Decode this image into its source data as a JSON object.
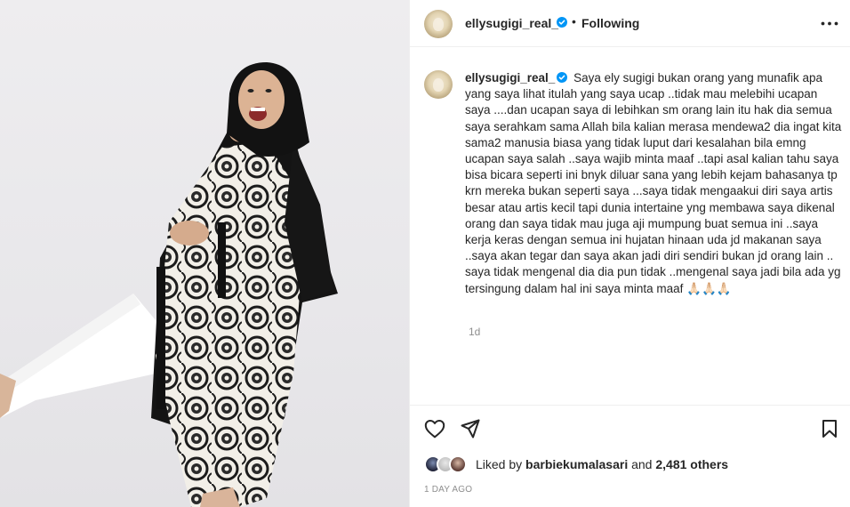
{
  "post": {
    "username": "ellysugigi_real_",
    "separator": "•",
    "follow_status": "Following",
    "caption_text": "Saya ely sugigi bukan orang yang munafik apa yang saya lihat itulah yang saya ucap ..tidak mau melebihi ucapan saya ....dan ucapan saya di lebihkan sm orang lain itu hak dia semua saya serahkam sama Allah bila kalian merasa mendewa2 dia ingat kita sama2 manusia biasa yang tidak luput dari kesalahan bila emng ucapan saya salah ..saya wajib minta maaf ..tapi asal kalian tahu saya bisa bicara seperti ini bnyk diluar sana yang lebih kejam bahasanya tp krn mereka bukan seperti saya ...saya tidak mengaakui diri saya artis besar atau artis kecil tapi dunia intertaine yng membawa saya dikenal orang dan saya tidak mau juga aji mumpung buat semua ini ..saya kerja keras dengan semua ini hujatan hinaan uda jd makanan saya ..saya akan tegar dan saya akan jadi diri sendiri bukan jd orang lain .. saya tidak mengenal dia dia pun tidak ..mengenal saya jadi bila ada yg tersingung dalam hal ini saya minta maaf 🙏🏻🙏🏻🙏🏻",
    "caption_age": "1d",
    "liked_by_prefix": "Liked by",
    "liked_by_user": "barbiekumalasari",
    "liked_by_and": "and",
    "others_count": "2,481 others",
    "date": "1 DAY AGO"
  },
  "icons": {
    "more": "more-horizontal-icon",
    "like": "heart-icon",
    "share": "paper-plane-icon",
    "save": "bookmark-icon",
    "verified": "verified-badge-icon"
  },
  "colors": {
    "verified_blue": "#0095f6",
    "muted_text": "#8e8e8e",
    "primary_text": "#262626",
    "divider": "#efefef"
  }
}
